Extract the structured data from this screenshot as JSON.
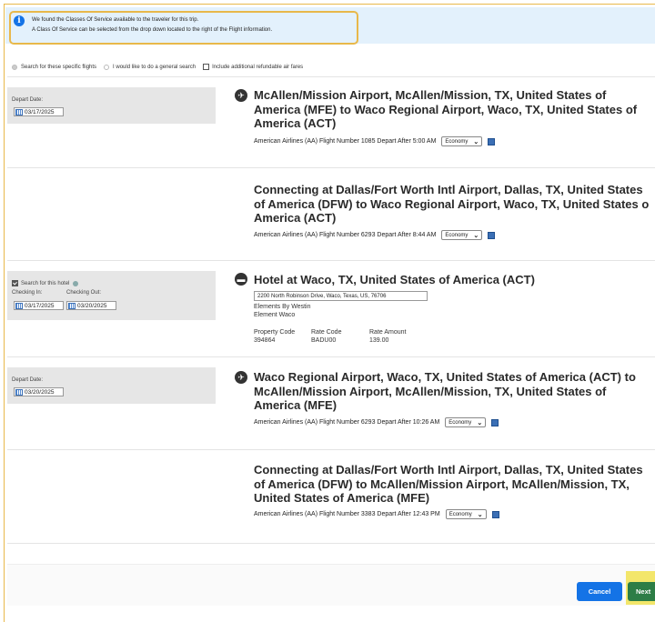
{
  "banner": {
    "line1": "We found the Classes Of Service available to the traveler for this trip.",
    "line2": "A Class Of Service can be selected from the drop down located to the right of the Flight information."
  },
  "options": {
    "specific": "Search for these specific flights",
    "general": "I would like to do a general search",
    "refundable": "Include additional refundable air fares"
  },
  "segments": [
    {
      "depart_label": "Depart Date:",
      "depart_date": "03/17/2025",
      "title_lines": [
        "McAllen/Mission Airport, McAllen/Mission, TX, United States of",
        "America (MFE) to Waco Regional Airport, Waco, TX, United States of",
        "America (ACT)"
      ],
      "airline": "American Airlines (AA)",
      "flight": "Flight Number 1085",
      "depart_after": "Depart After 5:00 AM",
      "cabin": "Economy"
    },
    {
      "title_lines": [
        "Connecting at Dallas/Fort Worth Intl Airport, Dallas, TX, United States",
        "of America (DFW) to Waco Regional Airport, Waco, TX, United States o",
        "America (ACT)"
      ],
      "airline": "American Airlines (AA)",
      "flight": "Flight Number 6293",
      "depart_after": "Depart After 8:44 AM",
      "cabin": "Economy"
    },
    {
      "depart_label": "Depart Date:",
      "depart_date": "03/20/2025",
      "title_lines": [
        "Waco Regional Airport, Waco, TX, United States of America (ACT) to",
        "McAllen/Mission Airport, McAllen/Mission, TX, United States of",
        "America (MFE)"
      ],
      "airline": "American Airlines (AA)",
      "flight": "Flight Number 6293",
      "depart_after": "Depart After 10:26 AM",
      "cabin": "Economy"
    },
    {
      "title_lines": [
        "Connecting at Dallas/Fort Worth Intl Airport, Dallas, TX, United States",
        "of America (DFW) to McAllen/Mission Airport, McAllen/Mission, TX,",
        "United States of America (MFE)"
      ],
      "airline": "American Airlines (AA)",
      "flight": "Flight Number 3383",
      "depart_after": "Depart After 12:43 PM",
      "cabin": "Economy"
    }
  ],
  "hotel": {
    "search_label": "Search for this hotel",
    "checkin_label": "Checking In:",
    "checkout_label": "Checking Out:",
    "checkin_date": "03/17/2025",
    "checkout_date": "03/20/2025",
    "title": "Hotel at Waco, TX, United States of America (ACT)",
    "address": "2200 North Robinson Drive, Waco, Texas, US, 76706",
    "name_line1": "Elements By Westin",
    "name_line2": "Element Waco",
    "property_code_label": "Property Code",
    "property_code": "394864",
    "rate_code_label": "Rate Code",
    "rate_code": "BADU00",
    "rate_amount_label": "Rate Amount",
    "rate_amount": "139.00"
  },
  "buttons": {
    "cancel": "Cancel",
    "next": "Next"
  },
  "colors": {
    "accent": "#1473e6",
    "next": "#2d7d46",
    "highlight": "#e8b84a"
  }
}
